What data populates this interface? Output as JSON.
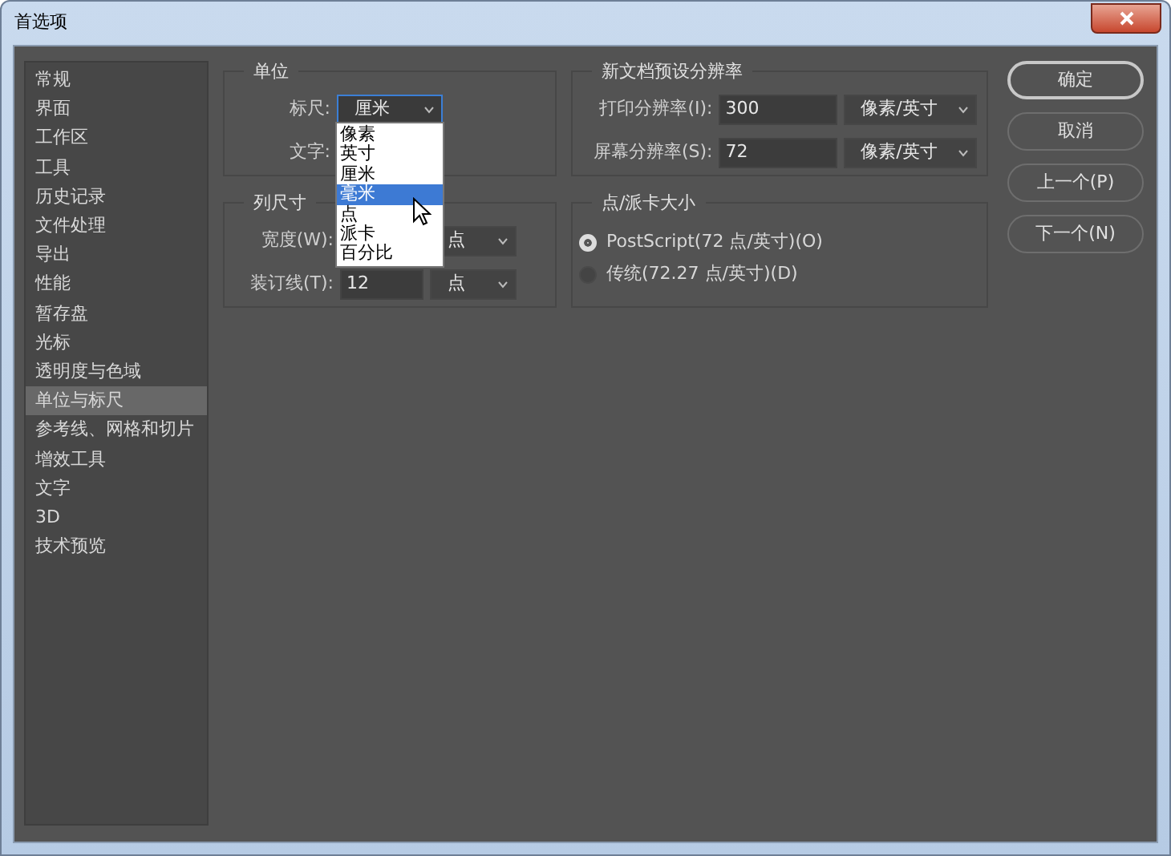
{
  "window": {
    "title": "首选项"
  },
  "sidebar": {
    "items": [
      {
        "label": "常规",
        "selected": false
      },
      {
        "label": "界面",
        "selected": false
      },
      {
        "label": "工作区",
        "selected": false
      },
      {
        "label": "工具",
        "selected": false
      },
      {
        "label": "历史记录",
        "selected": false
      },
      {
        "label": "文件处理",
        "selected": false
      },
      {
        "label": "导出",
        "selected": false
      },
      {
        "label": "性能",
        "selected": false
      },
      {
        "label": "暂存盘",
        "selected": false
      },
      {
        "label": "光标",
        "selected": false
      },
      {
        "label": "透明度与色域",
        "selected": false
      },
      {
        "label": "单位与标尺",
        "selected": true
      },
      {
        "label": "参考线、网格和切片",
        "selected": false
      },
      {
        "label": "增效工具",
        "selected": false
      },
      {
        "label": "文字",
        "selected": false
      },
      {
        "label": "3D",
        "selected": false
      },
      {
        "label": "技术预览",
        "selected": false
      }
    ]
  },
  "units": {
    "title": "单位",
    "ruler_label": "标尺:",
    "ruler_value": "厘米",
    "type_label": "文字:",
    "ruler_menu": {
      "expanded": true,
      "options": [
        {
          "label": "像素",
          "selected": false
        },
        {
          "label": "英寸",
          "selected": false
        },
        {
          "label": "厘米",
          "selected": false
        },
        {
          "label": "毫米",
          "selected": true
        },
        {
          "label": "点",
          "selected": false
        },
        {
          "label": "派卡",
          "selected": false
        },
        {
          "label": "百分比",
          "selected": false
        }
      ]
    }
  },
  "column_size": {
    "title": "列尺寸",
    "width_label": "宽度(W):",
    "width_unit": "点",
    "gutter_label": "装订线(T):",
    "gutter_value": "12",
    "gutter_unit": "点"
  },
  "new_doc_resolution": {
    "title": "新文档预设分辨率",
    "print_label": "打印分辨率(I):",
    "print_value": "300",
    "print_unit": "像素/英寸",
    "screen_label": "屏幕分辨率(S):",
    "screen_value": "72",
    "screen_unit": "像素/英寸"
  },
  "point_pica_size": {
    "title": "点/派卡大小",
    "options": [
      {
        "label": "PostScript(72 点/英寸)(O)",
        "selected": true
      },
      {
        "label": "传统(72.27 点/英寸)(D)",
        "selected": false
      }
    ]
  },
  "buttons": [
    {
      "label": "确定",
      "kind": "default"
    },
    {
      "label": "取消",
      "kind": "normal"
    },
    {
      "label": "上一个(P)",
      "kind": "normal"
    },
    {
      "label": "下一个(N)",
      "kind": "normal"
    }
  ]
}
